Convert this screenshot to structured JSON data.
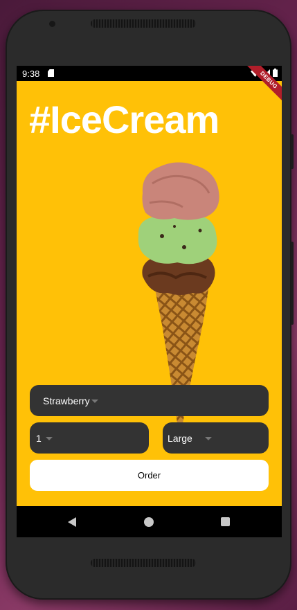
{
  "status_bar": {
    "time": "9:38"
  },
  "debug_banner": "DEBUG",
  "app": {
    "title": "#IceCream",
    "flavor": {
      "selected": "Strawberry"
    },
    "quantity": {
      "selected": "1"
    },
    "size": {
      "selected": "Large"
    },
    "order_button_label": "Order"
  },
  "colors": {
    "app_background": "#ffc107",
    "dropdown_background": "#333333",
    "debug_banner": "#b01e2a"
  },
  "icons": {
    "status": [
      "sd-card-icon",
      "wifi-icon",
      "cell-signal-icon",
      "battery-icon"
    ],
    "nav": [
      "back-icon",
      "home-icon",
      "recents-icon"
    ]
  }
}
